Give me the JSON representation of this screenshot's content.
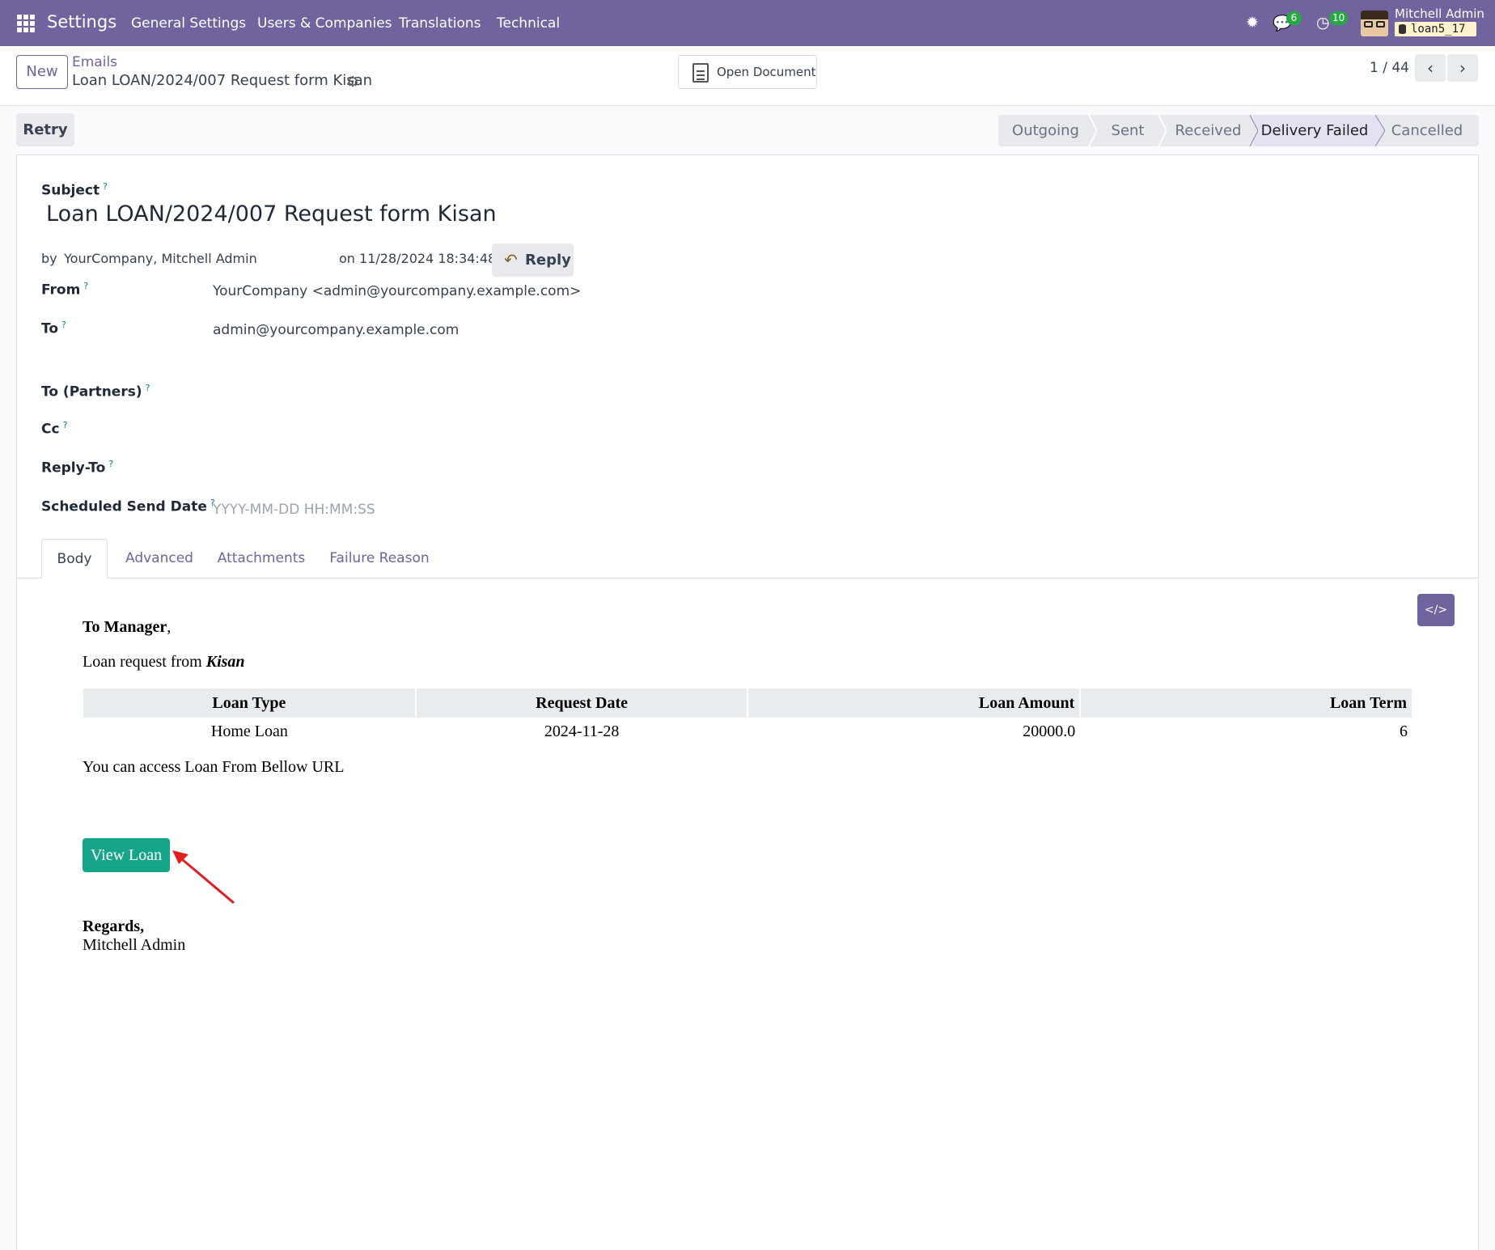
{
  "navbar": {
    "app_name": "Settings",
    "menu": [
      "General Settings",
      "Users & Companies",
      "Translations",
      "Technical"
    ],
    "messages_count": "6",
    "activities_count": "10",
    "user_name": "Mitchell Admin",
    "database": "loan5_17"
  },
  "control": {
    "new_label": "New",
    "breadcrumb_parent": "Emails",
    "breadcrumb_current": "Loan LOAN/2024/007 Request form Kisan",
    "open_document_label": "Open Document",
    "pager": "1 / 44"
  },
  "actions": {
    "retry_label": "Retry"
  },
  "statusbar": {
    "stages": [
      "Outgoing",
      "Sent",
      "Received",
      "Delivery Failed",
      "Cancelled"
    ],
    "active": "Delivery Failed"
  },
  "form": {
    "subject_label": "Subject",
    "subject": "Loan LOAN/2024/007 Request form Kisan",
    "by_prefix": "by",
    "author": "YourCompany, Mitchell Admin",
    "date_text": "on 11/28/2024 18:34:48",
    "reply_label": "Reply",
    "from_label": "From",
    "from_value": "YourCompany <admin@yourcompany.example.com>",
    "to_label": "To",
    "to_value": "admin@yourcompany.example.com",
    "to_partners_label": "To (Partners)",
    "cc_label": "Cc",
    "reply_to_label": "Reply-To",
    "scheduled_label": "Scheduled Send Date",
    "scheduled_placeholder": "YYYY-MM-DD HH:MM:SS",
    "help_mark": "?"
  },
  "tabs": [
    "Body",
    "Advanced",
    "Attachments",
    "Failure Reason"
  ],
  "active_tab": "Body",
  "email": {
    "greeting": "To Manager",
    "greeting_punct": ",",
    "request_prefix": "Loan request from ",
    "requester": "Kisan",
    "table_headers": [
      "Loan Type",
      "Request Date",
      "Loan Amount",
      "Loan Term"
    ],
    "table_row": [
      "Home Loan",
      "2024-11-28",
      "20000.0",
      "6"
    ],
    "access_text": "You can access Loan From Bellow URL",
    "view_button": "View Loan",
    "regards": "Regards,",
    "signature": "Mitchell Admin"
  },
  "colors": {
    "brand": "#71639e",
    "view_button": "#17a589",
    "badge": "#28a745",
    "annotation_arrow": "#e02020"
  },
  "icons": [
    "apps-grid-icon",
    "bug-icon",
    "chat-icon",
    "clock-icon",
    "gear-icon",
    "document-icon",
    "reply-icon",
    "chevron-left-icon",
    "chevron-right-icon",
    "code-icon"
  ]
}
